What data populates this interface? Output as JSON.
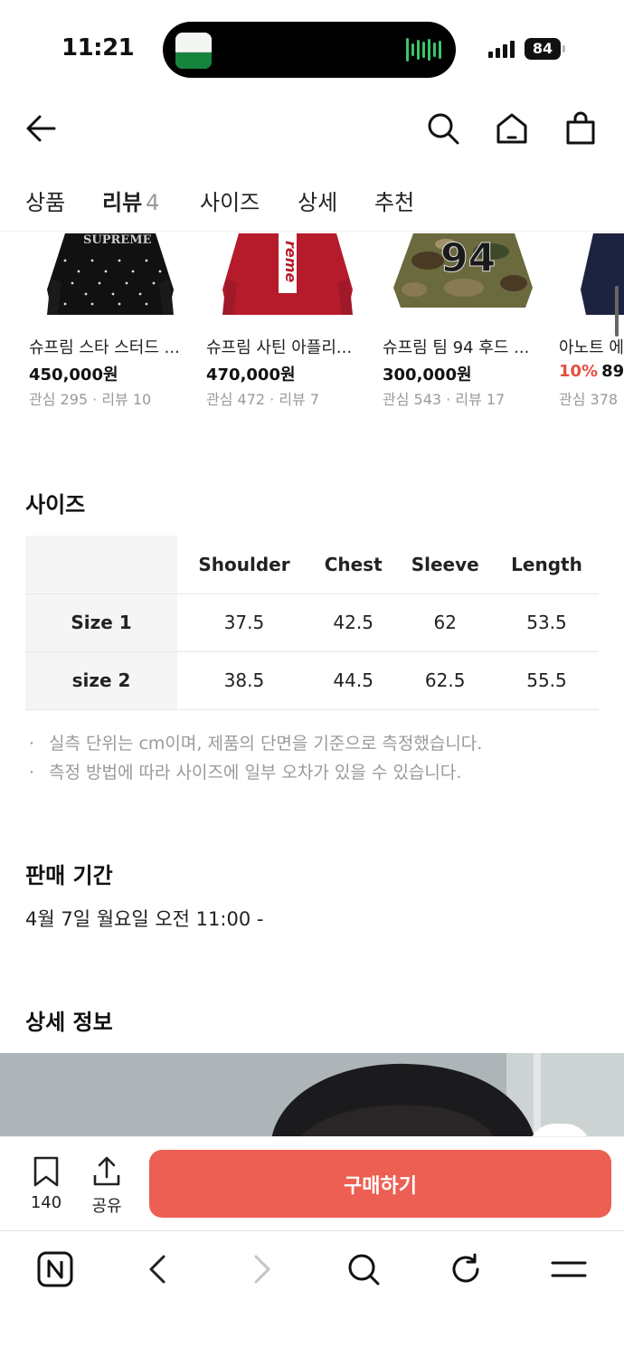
{
  "status_bar": {
    "time": "11:21",
    "battery": "84"
  },
  "header": {
    "icons": [
      "back-arrow-icon",
      "search-icon",
      "home-icon",
      "shopping-bag-icon"
    ]
  },
  "tabs": [
    {
      "label": "상품",
      "count": ""
    },
    {
      "label": "리뷰",
      "count": "4"
    },
    {
      "label": "사이즈",
      "count": ""
    },
    {
      "label": "상세",
      "count": ""
    },
    {
      "label": "추천",
      "count": ""
    }
  ],
  "recommendations": [
    {
      "name": "슈프림 스타 스터드 ...",
      "discount": "",
      "price": "450,000원",
      "meta": "관심 295 · 리뷰 10",
      "thumb_text": "SUPREME"
    },
    {
      "name": "슈프림 사틴 아플리...",
      "discount": "",
      "price": "470,000원",
      "meta": "관심 472 · 리뷰 7",
      "thumb_text": "reme"
    },
    {
      "name": "슈프림 팀 94 후드 ...",
      "discount": "",
      "price": "300,000원",
      "meta": "관심 543 · 리뷰 17",
      "thumb_text": "94"
    },
    {
      "name": "아노트 에",
      "discount": "10%",
      "price": "89,",
      "meta": "관심 378",
      "thumb_text": ""
    }
  ],
  "size_section": {
    "title": "사이즈",
    "columns": [
      "Shoulder",
      "Chest",
      "Sleeve",
      "Length"
    ],
    "rows": [
      {
        "label": "Size 1",
        "values": [
          "37.5",
          "42.5",
          "62",
          "53.5"
        ]
      },
      {
        "label": "size 2",
        "values": [
          "38.5",
          "44.5",
          "62.5",
          "55.5"
        ]
      }
    ],
    "notes": [
      "실측 단위는 cm이며, 제품의 단면을 기준으로 측정했습니다.",
      "측정 방법에 따라 사이즈에 일부 오차가 있을 수 있습니다."
    ]
  },
  "sale_period": {
    "title": "판매 기간",
    "value": "4월 7일 월요일 오전 11:00 -"
  },
  "detail": {
    "title": "상세 정보"
  },
  "action_bar": {
    "bookmark_count": "140",
    "share_label": "공유",
    "buy_label": "구매하기"
  },
  "colors": {
    "accent": "#ec5f52",
    "discount": "#e4503f"
  }
}
